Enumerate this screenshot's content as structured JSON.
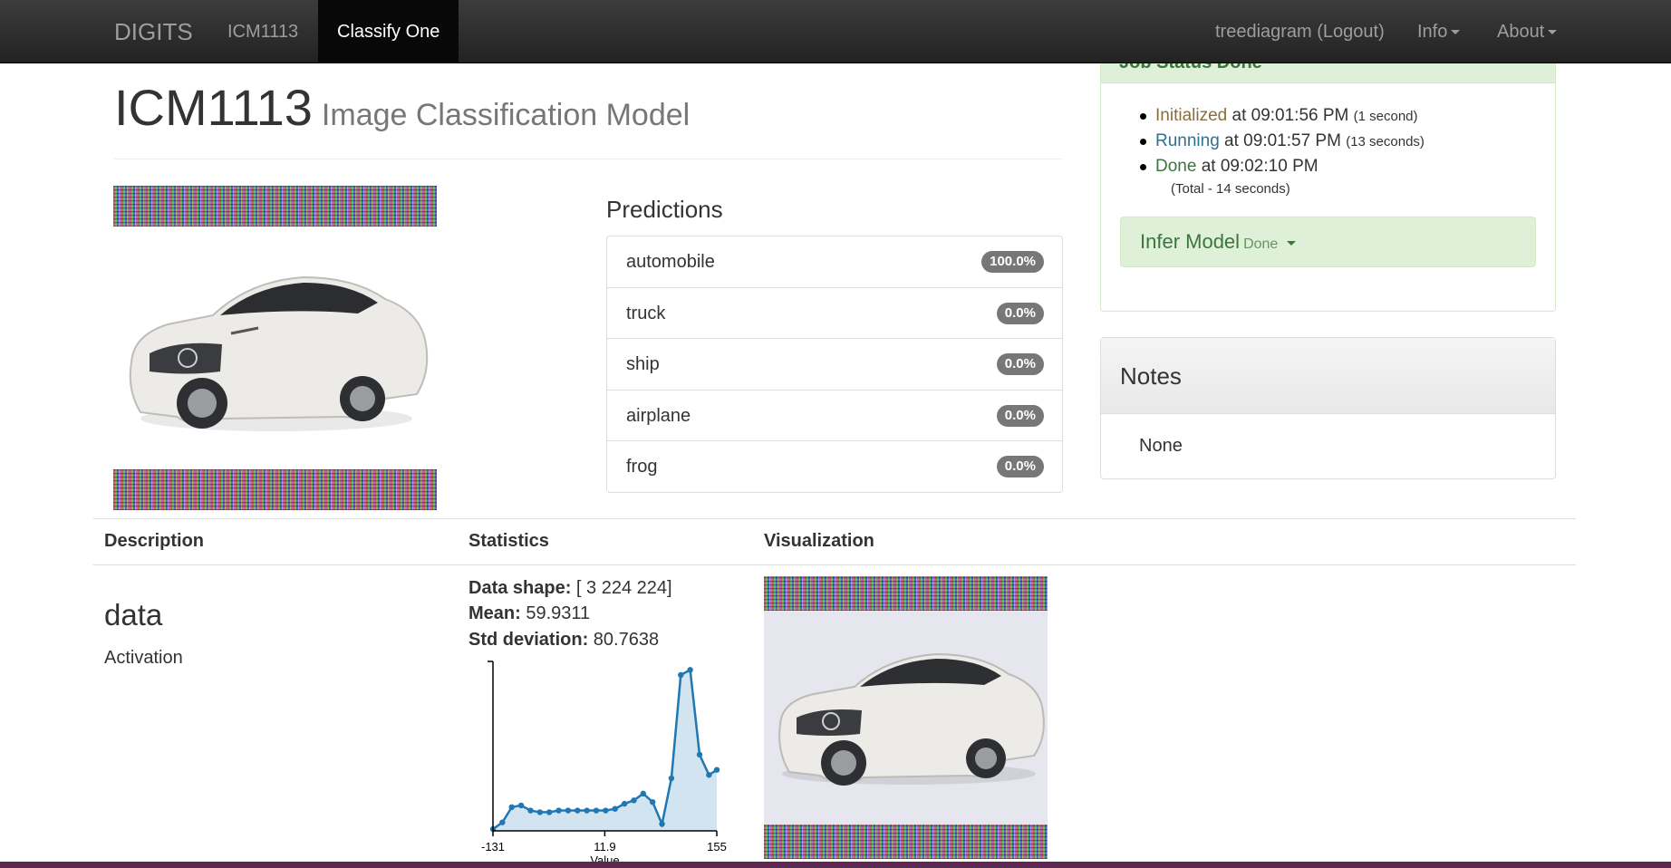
{
  "navbar": {
    "brand": "DIGITS",
    "items": [
      {
        "label": "ICM1113"
      },
      {
        "label": "Classify One"
      }
    ],
    "user": "treediagram (Logout)",
    "info": "Info",
    "about": "About"
  },
  "header": {
    "title": "ICM1113",
    "subtitle": "Image Classification Model"
  },
  "predictions": {
    "title": "Predictions",
    "rows": [
      {
        "label": "automobile",
        "value": "100.0%"
      },
      {
        "label": "truck",
        "value": "0.0%"
      },
      {
        "label": "ship",
        "value": "0.0%"
      },
      {
        "label": "airplane",
        "value": "0.0%"
      },
      {
        "label": "frog",
        "value": "0.0%"
      }
    ]
  },
  "job_status": {
    "heading": "Job Status Done",
    "entries": [
      {
        "state": "Initialized",
        "text": " at 09:01:56 PM ",
        "duration": "(1 second)"
      },
      {
        "state": "Running",
        "text": " at 09:01:57 PM ",
        "duration": "(13 seconds)"
      },
      {
        "state": "Done",
        "text": " at 09:02:10 PM",
        "duration": ""
      }
    ],
    "total": "(Total - 14 seconds)",
    "infer_label": "Infer Model",
    "infer_status": "Done"
  },
  "notes": {
    "title": "Notes",
    "body": "None"
  },
  "table": {
    "headers": {
      "description": "Description",
      "statistics": "Statistics",
      "visualization": "Visualization"
    },
    "layer": {
      "name": "data",
      "type": "Activation"
    },
    "stats": {
      "shape_label": "Data shape:",
      "shape_value": " [ 3 224 224]",
      "mean_label": "Mean:",
      "mean_value": " 59.9311",
      "std_label": "Std deviation:",
      "std_value": " 80.7638"
    }
  },
  "chart_data": {
    "type": "area",
    "xlabel": "Value",
    "x_ticks": [
      "-131",
      "11.9",
      "155"
    ],
    "xlim": [
      -131,
      155
    ],
    "x": [
      -131,
      -119,
      -107,
      -95,
      -83,
      -71,
      -59,
      -47,
      -35,
      -23,
      -11,
      1,
      13,
      25,
      37,
      49,
      61,
      73,
      85,
      97,
      109,
      121,
      133,
      145,
      155
    ],
    "values": [
      0.01,
      0.05,
      0.14,
      0.15,
      0.12,
      0.11,
      0.11,
      0.12,
      0.12,
      0.12,
      0.12,
      0.12,
      0.12,
      0.13,
      0.16,
      0.18,
      0.22,
      0.17,
      0.04,
      0.31,
      0.92,
      0.95,
      0.45,
      0.33,
      0.36
    ],
    "color": "#1f77b4"
  },
  "colors": {
    "navbar": "#222222",
    "success_bg": "#dff0d8",
    "success_text": "#3c763d",
    "badge": "#777777",
    "warning_text": "#8a6d3b",
    "info_text": "#31708f"
  }
}
